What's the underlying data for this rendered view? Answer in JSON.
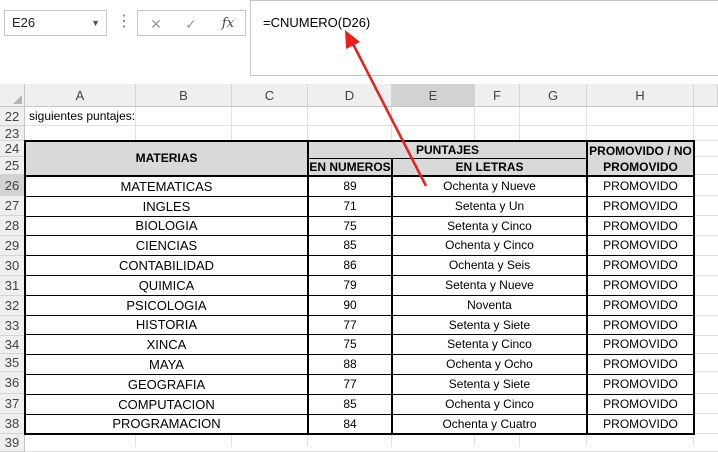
{
  "name_box": {
    "value": "E26"
  },
  "formula_bar": {
    "formula": "=CNUMERO(D26)",
    "cancel_icon": "close-icon",
    "enter_icon": "check-icon",
    "function_icon": "fx-icon"
  },
  "columns": [
    "A",
    "B",
    "C",
    "D",
    "E",
    "F",
    "G",
    "H"
  ],
  "rows": [
    "22",
    "23",
    "24",
    "25",
    "26",
    "27",
    "28",
    "29",
    "30",
    "31",
    "32",
    "33",
    "34",
    "35",
    "36",
    "37",
    "38",
    "39"
  ],
  "cell_a22": "siguientes puntajes:",
  "table": {
    "header_materias": "MATERIAS",
    "header_puntajes": "PUNTAJES",
    "header_numeros": "EN NUMEROS",
    "header_letras": "EN LETRAS",
    "header_promovido_1": "PROMOVIDO / NO",
    "header_promovido_2": "PROMOVIDO",
    "rows": [
      {
        "materia": "MATEMATICAS",
        "numero": "89",
        "letras": "Ochenta y Nueve",
        "estado": "PROMOVIDO"
      },
      {
        "materia": "INGLES",
        "numero": "71",
        "letras": "Setenta y Un",
        "estado": "PROMOVIDO"
      },
      {
        "materia": "BIOLOGIA",
        "numero": "75",
        "letras": "Setenta y Cinco",
        "estado": "PROMOVIDO"
      },
      {
        "materia": "CIENCIAS",
        "numero": "85",
        "letras": "Ochenta y Cinco",
        "estado": "PROMOVIDO"
      },
      {
        "materia": "CONTABILIDAD",
        "numero": "86",
        "letras": "Ochenta y Seis",
        "estado": "PROMOVIDO"
      },
      {
        "materia": "QUIMICA",
        "numero": "79",
        "letras": "Setenta y Nueve",
        "estado": "PROMOVIDO"
      },
      {
        "materia": "PSICOLOGIA",
        "numero": "90",
        "letras": "Noventa",
        "estado": "PROMOVIDO"
      },
      {
        "materia": "HISTORIA",
        "numero": "77",
        "letras": "Setenta y Siete",
        "estado": "PROMOVIDO"
      },
      {
        "materia": "XINCA",
        "numero": "75",
        "letras": "Setenta y Cinco",
        "estado": "PROMOVIDO"
      },
      {
        "materia": "MAYA",
        "numero": "88",
        "letras": "Ochenta y Ocho",
        "estado": "PROMOVIDO"
      },
      {
        "materia": "GEOGRAFIA",
        "numero": "77",
        "letras": "Setenta y Siete",
        "estado": "PROMOVIDO"
      },
      {
        "materia": "COMPUTACION",
        "numero": "85",
        "letras": "Ochenta y Cinco",
        "estado": "PROMOVIDO"
      },
      {
        "materia": "PROGRAMACION",
        "numero": "84",
        "letras": "Ochenta y Cuatro",
        "estado": "PROMOVIDO"
      }
    ]
  },
  "annotation_arrow_color": "#e8201a"
}
